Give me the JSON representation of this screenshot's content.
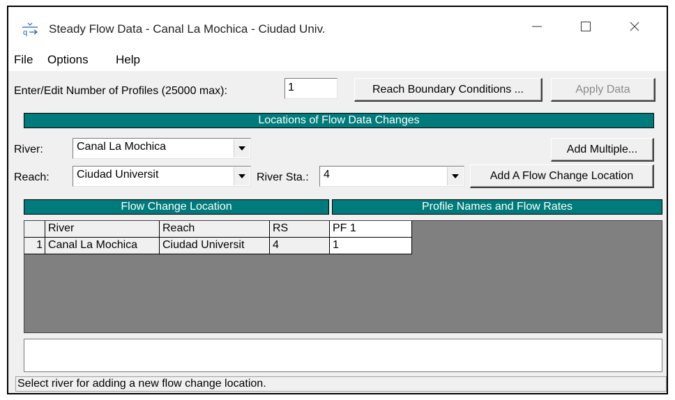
{
  "window": {
    "title": "Steady Flow Data - Canal La Mochica - Ciudad Univ.",
    "controls": {
      "minimize": "—",
      "maximize": "☐",
      "close": "✕"
    }
  },
  "menu": {
    "items": [
      "File",
      "Options",
      "Help"
    ]
  },
  "profiles": {
    "label": "Enter/Edit Number of Profiles (25000 max):",
    "value": "1",
    "reach_boundary_button": "Reach Boundary Conditions ...",
    "apply_button": "Apply Data"
  },
  "locations_header": "Locations of Flow Data Changes",
  "river": {
    "label": "River:",
    "value": "Canal La Mochica"
  },
  "add_multiple_button": "Add Multiple...",
  "reach": {
    "label": "Reach:",
    "value": "Ciudad Universit"
  },
  "river_sta": {
    "label": "River Sta.:",
    "value": "4"
  },
  "add_flow_change_button": "Add A Flow Change Location",
  "section_headers": {
    "left": "Flow Change Location",
    "right": "Profile Names and Flow Rates"
  },
  "table": {
    "columns": [
      "",
      "River",
      "Reach",
      "RS",
      "PF 1"
    ],
    "rows": [
      [
        "1",
        "Canal La Mochica",
        "Ciudad Universit",
        "4",
        "1"
      ]
    ]
  },
  "status_text": "Select river for adding a new flow change location.",
  "colors": {
    "teal": "#007b7b",
    "grid_bg": "#808080"
  }
}
